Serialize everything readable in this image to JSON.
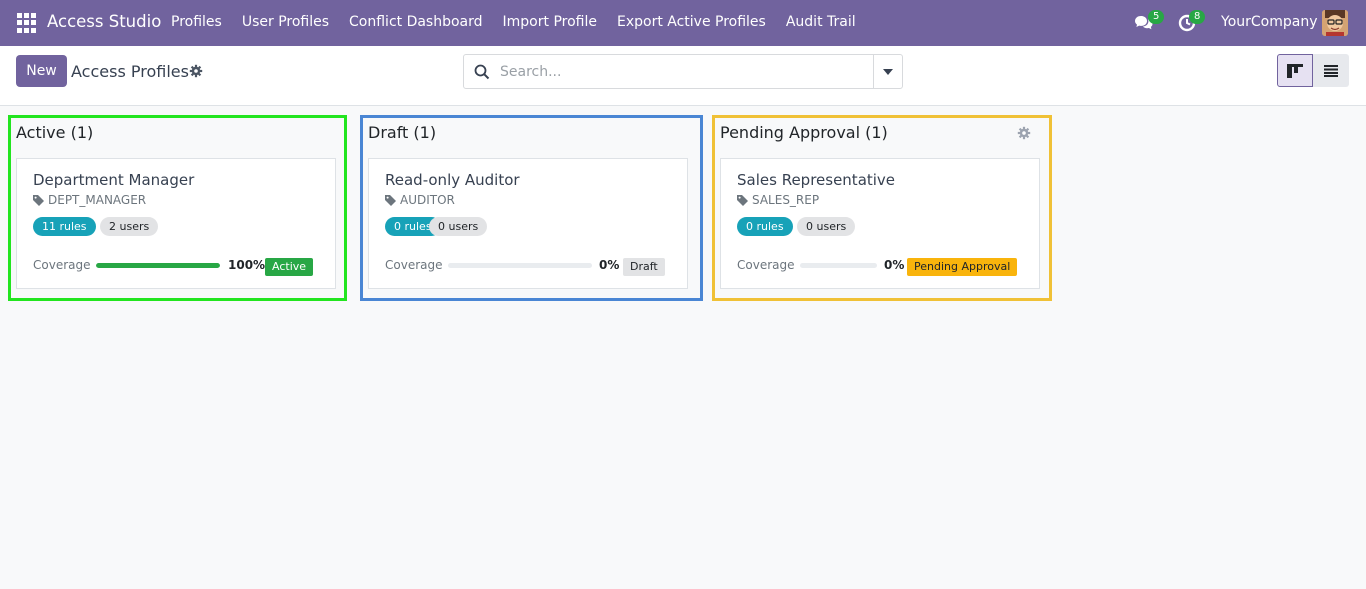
{
  "navbar": {
    "brand": "Access Studio",
    "menu": [
      "Profiles",
      "User Profiles",
      "Conflict Dashboard",
      "Import Profile",
      "Export Active Profiles",
      "Audit Trail"
    ],
    "messages_count": "5",
    "activities_count": "8",
    "company": "YourCompany",
    "color": "#71639e"
  },
  "control": {
    "new_label": "New",
    "title": "Access Profiles",
    "search_placeholder": "Search..."
  },
  "columns": [
    {
      "title": "Active (1)",
      "border_color": "#22e51f",
      "card": {
        "name": "Department Manager",
        "code": "DEPT_MANAGER",
        "rules": "11 rules",
        "users": "2 users",
        "coverage_label": "Coverage",
        "coverage": 100,
        "coverage_text": "100%",
        "status": "Active",
        "status_color": "#28a745"
      }
    },
    {
      "title": "Draft (1)",
      "border_color": "#4a86d4",
      "card": {
        "name": "Read-only Auditor",
        "code": "AUDITOR",
        "rules": "0 rules",
        "users": "0 users",
        "coverage_label": "Coverage",
        "coverage": 0,
        "coverage_text": "0%",
        "status": "Draft",
        "status_color": "#e2e3e5"
      }
    },
    {
      "title": "Pending Approval (1)",
      "border_color": "#f0c136",
      "card": {
        "name": "Sales Representative",
        "code": "SALES_REP",
        "rules": "0 rules",
        "users": "0 users",
        "coverage_label": "Coverage",
        "coverage": 0,
        "coverage_text": "0%",
        "status": "Pending Approval",
        "status_color": "#f9b40c"
      }
    }
  ]
}
